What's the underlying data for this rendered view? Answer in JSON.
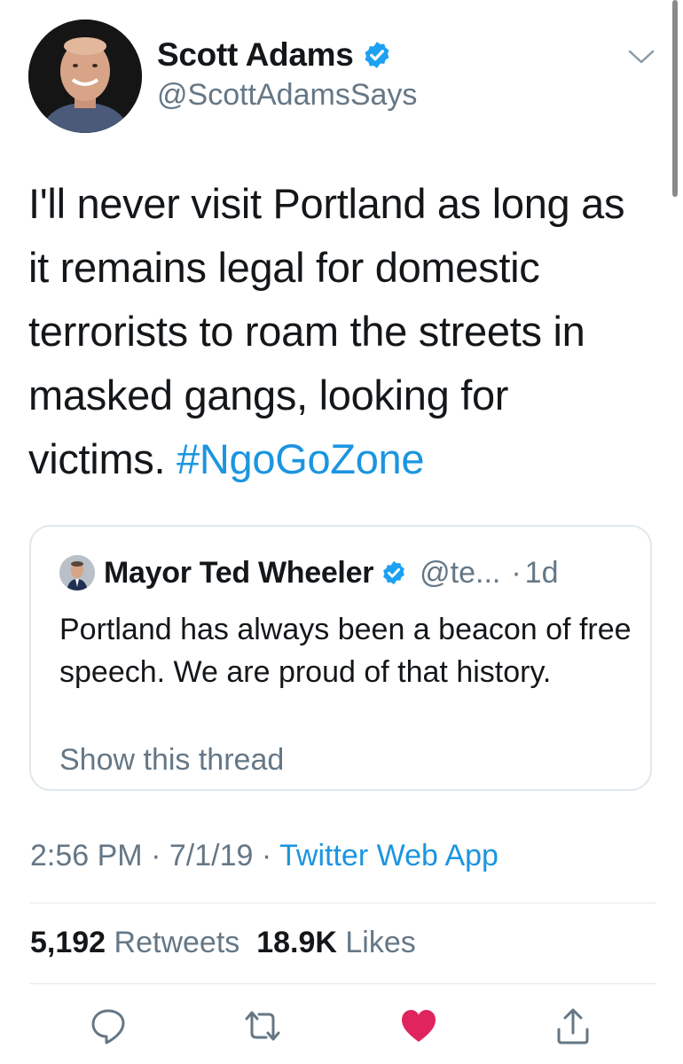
{
  "author": {
    "display_name": "Scott Adams",
    "handle": "@ScottAdamsSays",
    "verified": true
  },
  "icons": {
    "avatar": "avatar-photo",
    "verified": "verified-badge-icon",
    "menu": "chevron-down-icon",
    "reply": "reply-icon",
    "retweet": "retweet-icon",
    "like": "heart-icon",
    "share": "share-icon"
  },
  "tweet": {
    "text": "I'll never visit Portland as long as it remains legal for domestic terrorists to roam the streets in masked gangs, looking for victims.",
    "hashtag": "#NgoGoZone"
  },
  "quoted_tweet": {
    "display_name": "Mayor Ted Wheeler",
    "handle": "@te...",
    "separator": "·",
    "time": "1d",
    "text": "Portland has always been a beacon of free speech. We are proud of that history.",
    "show_thread": "Show this thread"
  },
  "meta": {
    "time": "2:56 PM",
    "date": "7/1/19",
    "separator": "·",
    "source": "Twitter Web App"
  },
  "stats": {
    "retweets_count": "5,192",
    "retweets_label": "Retweets",
    "likes_count": "18.9K",
    "likes_label": "Likes"
  },
  "colors": {
    "link": "#1b95e0",
    "secondary_text": "#657786",
    "primary_text": "#14171a",
    "like": "#e0245e",
    "divider": "#e1e8ed"
  }
}
